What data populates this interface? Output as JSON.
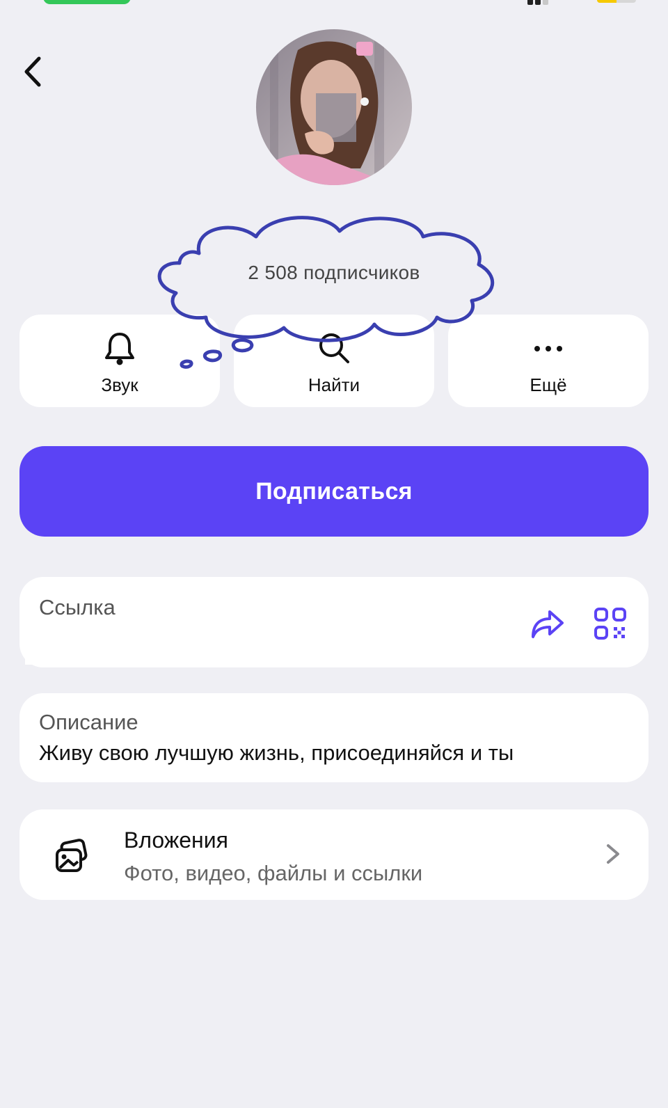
{
  "header": {
    "back_icon": "chevron-left-icon",
    "avatar_description": "profile-photo"
  },
  "profile": {
    "followers": "2 508 подписчиков"
  },
  "actions": [
    {
      "label": "Звук",
      "icon": "bell-icon"
    },
    {
      "label": "Найти",
      "icon": "search-icon"
    },
    {
      "label": "Ещё",
      "icon": "more-icon"
    }
  ],
  "subscribe": {
    "label": "Подписаться"
  },
  "link": {
    "caption": "Ссылка",
    "share_icon": "share-icon",
    "qr_icon": "qr-code-icon"
  },
  "description": {
    "caption": "Описание",
    "text": "Живу свою лучшую жизнь, присоединяйся и ты"
  },
  "attachments": {
    "title": "Вложения",
    "subtitle": "Фото, видео, файлы и ссылки",
    "icon": "gallery-icon"
  },
  "colors": {
    "accent": "#5b43f5",
    "background": "#efeff4",
    "card": "#ffffff",
    "annotation": "#3a3fb0"
  }
}
